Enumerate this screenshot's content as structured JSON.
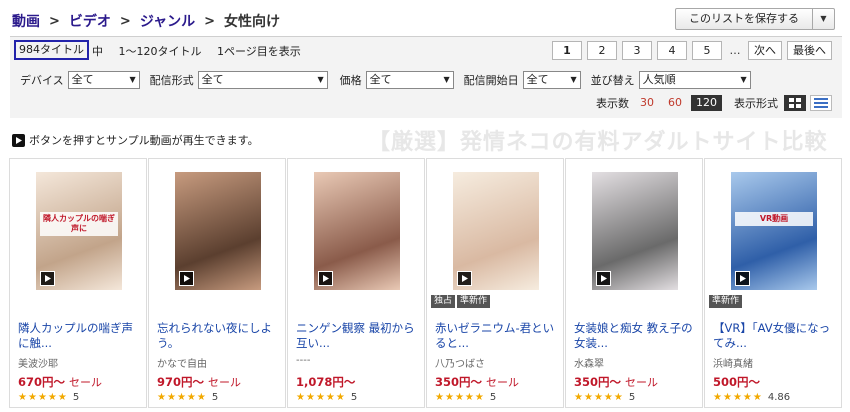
{
  "breadcrumb": {
    "items": [
      "動画",
      "ビデオ",
      "ジャンル"
    ],
    "separator": ">",
    "current": "女性向け"
  },
  "save_list": {
    "label": "このリストを保存する",
    "dropdown": "▼"
  },
  "results": {
    "total": "984タイトル",
    "total_suffix": "中",
    "range": "1〜120タイトル",
    "page_info": "1ページ目を表示"
  },
  "pager": {
    "pages": [
      "1",
      "2",
      "3",
      "4",
      "5"
    ],
    "current": "1",
    "dots": "…",
    "next": "次へ",
    "last": "最後へ"
  },
  "filters": {
    "device": {
      "label": "デバイス",
      "value": "全て"
    },
    "delivery": {
      "label": "配信形式",
      "value": "全て"
    },
    "price": {
      "label": "価格",
      "value": "全て"
    },
    "start_date": {
      "label": "配信開始日",
      "value": "全て"
    },
    "sort": {
      "label": "並び替え",
      "value": "人気順"
    }
  },
  "view": {
    "count_label": "表示数",
    "counts": [
      "30",
      "60",
      "120"
    ],
    "active_count": "120",
    "format_label": "表示形式",
    "grid_icon": "grid-view-icon",
    "list_icon": "list-view-icon"
  },
  "hint": "ボタンを押すとサンプル動画が再生できます。",
  "watermark": "【厳選】発情ネコの有料アダルトサイト比較",
  "colors": {
    "link": "#1a46a8",
    "price": "#c0182a",
    "star": "#f2a900",
    "breadcrumb": "#2b1a8c"
  },
  "products": [
    {
      "title": "隣人カップルの喘ぎ声に触...",
      "maker": "美波沙耶",
      "price": "670円〜",
      "sale": "セール",
      "rating": "5",
      "stars": 5,
      "badges": [],
      "thumb_colors": [
        "#c2a48a",
        "#f4e7da"
      ],
      "thumb_text": "隣人カップルの喘ぎ声に"
    },
    {
      "title": "忘れられない夜にしよう。",
      "maker": "かなで自由",
      "price": "970円〜",
      "sale": "セール",
      "rating": "5",
      "stars": 5,
      "badges": [],
      "thumb_colors": [
        "#5b3f2f",
        "#c79b7f"
      ],
      "thumb_text": ""
    },
    {
      "title": "ニンゲン観察 最初から互い...",
      "maker": "----",
      "price": "1,078円〜",
      "sale": "",
      "rating": "5",
      "stars": 5,
      "badges": [],
      "thumb_colors": [
        "#8a5b4a",
        "#e9c9b5"
      ],
      "thumb_text": ""
    },
    {
      "title": "赤いゼラニウム-君といると...",
      "maker": "八乃つばさ",
      "price": "350円〜",
      "sale": "セール",
      "rating": "5",
      "stars": 5,
      "badges": [
        "独占",
        "準新作"
      ],
      "thumb_colors": [
        "#d9b9a2",
        "#f6ecdf"
      ],
      "thumb_text": ""
    },
    {
      "title": "女装娘と痴女 教え子の女装...",
      "maker": "水森翠",
      "price": "350円〜",
      "sale": "セール",
      "rating": "5",
      "stars": 5,
      "badges": [],
      "thumb_colors": [
        "#6a6a6a",
        "#e3dfe2"
      ],
      "thumb_text": ""
    },
    {
      "title": "【VR】「AV女優になってみ...",
      "maker": "浜崎真緒",
      "price": "500円〜",
      "sale": "",
      "rating": "4.86",
      "stars": 5,
      "badges": [
        "準新作"
      ],
      "thumb_colors": [
        "#2f5fa8",
        "#a9c9ec"
      ],
      "thumb_text": "VR動画"
    }
  ]
}
